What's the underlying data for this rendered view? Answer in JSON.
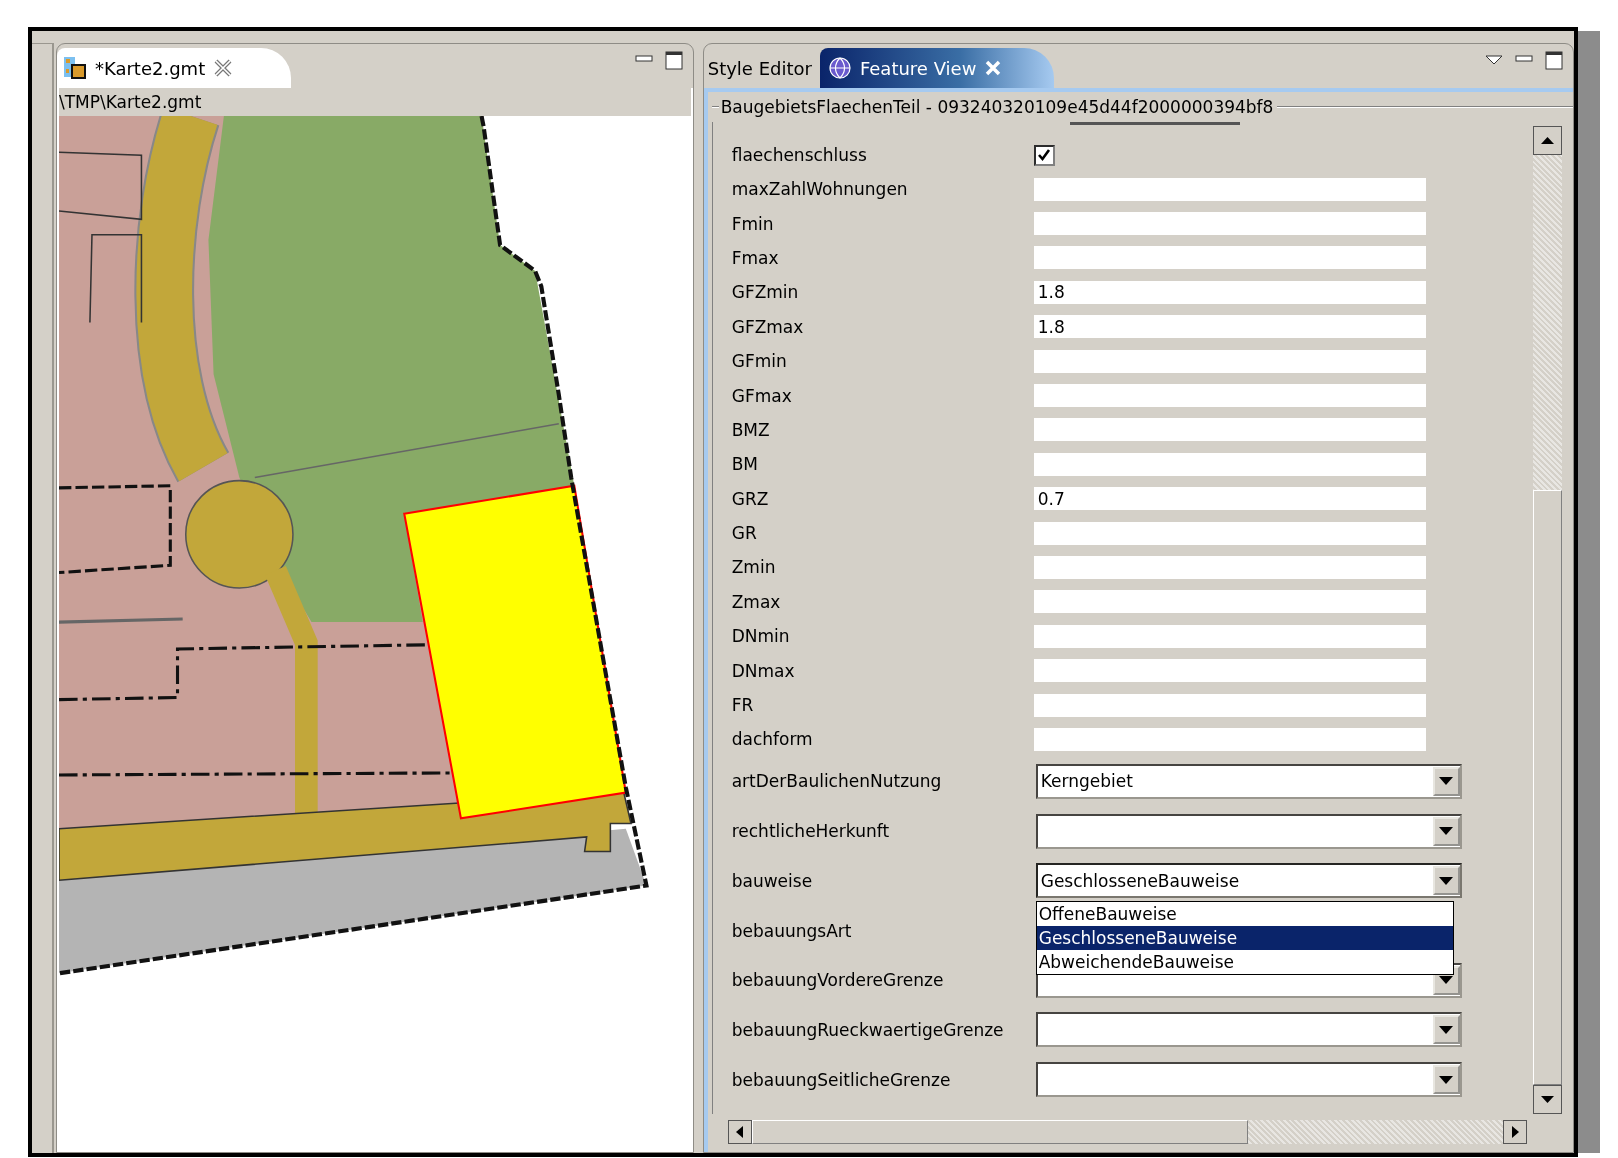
{
  "editor": {
    "tab": {
      "title": "*Karte2.gmt",
      "selected": true
    },
    "path": "\\TMP\\Karte2.gmt"
  },
  "view_tabs": [
    {
      "label": "Style Editor",
      "selected": false
    },
    {
      "label": "Feature View",
      "selected": true
    }
  ],
  "feature": {
    "title": "BaugebietsFlaechenTeil - 093240320109e45d44f2000000394bf8",
    "fields": [
      {
        "kind": "checkbox",
        "label": "flaechenschluss",
        "checked": true
      },
      {
        "kind": "text",
        "label": "maxZahlWohnungen"
      },
      {
        "kind": "text",
        "label": "Fmin"
      },
      {
        "kind": "text",
        "label": "Fmax"
      },
      {
        "kind": "text",
        "label": "GFZmin",
        "value": "1.8"
      },
      {
        "kind": "text",
        "label": "GFZmax",
        "value": "1.8"
      },
      {
        "kind": "text",
        "label": "GFmin"
      },
      {
        "kind": "text",
        "label": "GFmax"
      },
      {
        "kind": "text",
        "label": "BMZ"
      },
      {
        "kind": "text",
        "label": "BM"
      },
      {
        "kind": "text",
        "label": "GRZ",
        "value": "0.7"
      },
      {
        "kind": "text",
        "label": "GR"
      },
      {
        "kind": "text",
        "label": "Zmin"
      },
      {
        "kind": "text",
        "label": "Zmax"
      },
      {
        "kind": "text",
        "label": "DNmin"
      },
      {
        "kind": "text",
        "label": "DNmax"
      },
      {
        "kind": "text",
        "label": "FR"
      },
      {
        "kind": "text",
        "label": "dachform"
      },
      {
        "kind": "combo",
        "label": "artDerBaulichenNutzung",
        "value": "Kerngebiet",
        "open": false
      },
      {
        "kind": "combo",
        "label": "rechtlicheHerkunft",
        "open": false
      },
      {
        "kind": "combo",
        "label": "bauweise",
        "value": "GeschlosseneBauweise",
        "open": true,
        "options": [
          {
            "label": "OffeneBauweise",
            "selected": false
          },
          {
            "label": "GeschlosseneBauweise",
            "selected": true
          },
          {
            "label": "AbweichendeBauweise",
            "selected": false
          }
        ]
      },
      {
        "kind": "label",
        "label": "bebauungsArt"
      },
      {
        "kind": "combo",
        "label": "bebauungVordereGrenze",
        "open": false
      },
      {
        "kind": "combo",
        "label": "bebauungRueckwaertigeGrenze",
        "open": false
      },
      {
        "kind": "combo",
        "label": "bebauungSeitlicheGrenze",
        "open": false
      }
    ]
  }
}
